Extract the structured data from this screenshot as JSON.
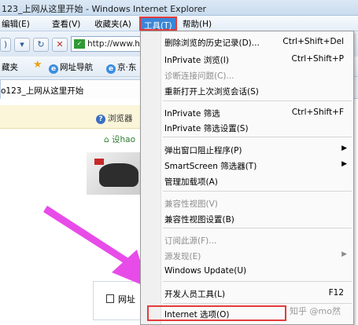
{
  "window": {
    "title": "123_上网从这里开始 - Windows Internet Explorer"
  },
  "menubar": {
    "items": [
      "编辑(E)",
      "查看(V)",
      "收藏夹(A)",
      "工具(T)",
      "帮助(H)"
    ]
  },
  "address": {
    "url": "http://www.h"
  },
  "favorites": {
    "items": [
      "藏夹",
      "网址导航",
      "京·东"
    ]
  },
  "tab": {
    "label": "o123_上网从这里开始"
  },
  "page": {
    "notice": "浏览器",
    "sethome": "设hao",
    "bottom_label": "网址"
  },
  "tools_menu": {
    "items": [
      {
        "label": "删除浏览的历史记录(D)...",
        "shortcut": "Ctrl+Shift+Del",
        "disabled": false
      },
      {
        "label": "InPrivate 浏览(I)",
        "shortcut": "Ctrl+Shift+P",
        "disabled": false
      },
      {
        "label": "诊断连接问题(C)...",
        "shortcut": "",
        "disabled": true
      },
      {
        "label": "重新打开上次浏览会话(S)",
        "shortcut": "",
        "disabled": false
      },
      {
        "label": "InPrivate 筛选",
        "shortcut": "Ctrl+Shift+F",
        "disabled": false
      },
      {
        "label": "InPrivate 筛选设置(S)",
        "shortcut": "",
        "disabled": false
      },
      {
        "label": "弹出窗口阻止程序(P)",
        "shortcut": "",
        "disabled": false,
        "submenu": true
      },
      {
        "label": "SmartScreen 筛选器(T)",
        "shortcut": "",
        "disabled": false,
        "submenu": true
      },
      {
        "label": "管理加载项(A)",
        "shortcut": "",
        "disabled": false
      },
      {
        "label": "兼容性视图(V)",
        "shortcut": "",
        "disabled": true
      },
      {
        "label": "兼容性视图设置(B)",
        "shortcut": "",
        "disabled": false
      },
      {
        "label": "订阅此源(F)...",
        "shortcut": "",
        "disabled": true
      },
      {
        "label": "源发现(E)",
        "shortcut": "",
        "disabled": true,
        "submenu": true
      },
      {
        "label": "Windows Update(U)",
        "shortcut": "",
        "disabled": false
      },
      {
        "label": "开发人员工具(L)",
        "shortcut": "F12",
        "disabled": false
      },
      {
        "label": "Internet 选项(O)",
        "shortcut": "",
        "disabled": false
      }
    ]
  },
  "watermark": "知乎 @mo然",
  "colors": {
    "highlight_border": "#e23b3b",
    "menu_selected": "#3a86d8",
    "arrow": "#e84ce8"
  }
}
